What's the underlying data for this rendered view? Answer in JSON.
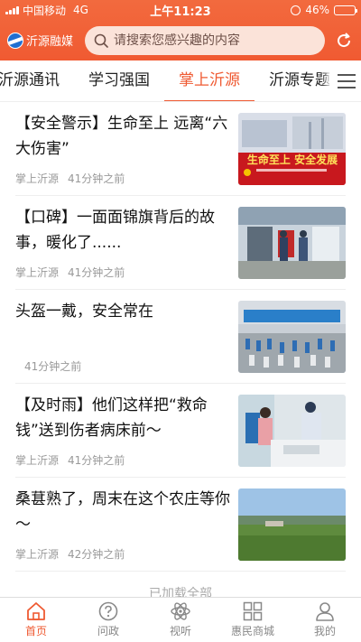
{
  "status_bar": {
    "carrier": "中国移动",
    "network": "4G",
    "time": "上午11:23",
    "battery": "46%",
    "battery_level": 0.46
  },
  "header": {
    "logo_text": "沂源融媒",
    "search_placeholder": "请搜索您感兴趣的内容",
    "accent_color": "#f05a32"
  },
  "tabs": [
    {
      "label": "沂源通讯"
    },
    {
      "label": "学习强国"
    },
    {
      "label": "掌上沂源",
      "active": true
    },
    {
      "label": "沂源专题"
    }
  ],
  "news": [
    {
      "title": "【安全警示】生命至上 远离“六大伤害”",
      "source": "掌上沂源",
      "time": "41分钟之前"
    },
    {
      "title": "【口碑】一面面锦旗背后的故事，暖化了......",
      "source": "掌上沂源",
      "time": "41分钟之前"
    },
    {
      "title": "头盔一戴，安全常在",
      "source": "",
      "time": "41分钟之前"
    },
    {
      "title": "【及时雨】他们这样把“救命钱”送到伤者病床前～",
      "source": "掌上沂源",
      "time": "41分钟之前"
    },
    {
      "title": "桑葚熟了，周末在这个农庄等你～",
      "source": "掌上沂源",
      "time": "42分钟之前"
    }
  ],
  "thumb_banner_text": "生命至上 安全发展",
  "list_footer": "已加载全部",
  "bottom_nav": [
    {
      "label": "首页",
      "icon": "home-icon",
      "active": true
    },
    {
      "label": "问政",
      "icon": "question-icon"
    },
    {
      "label": "视听",
      "icon": "atom-icon"
    },
    {
      "label": "惠民商城",
      "icon": "grid-icon"
    },
    {
      "label": "我的",
      "icon": "user-icon"
    }
  ]
}
